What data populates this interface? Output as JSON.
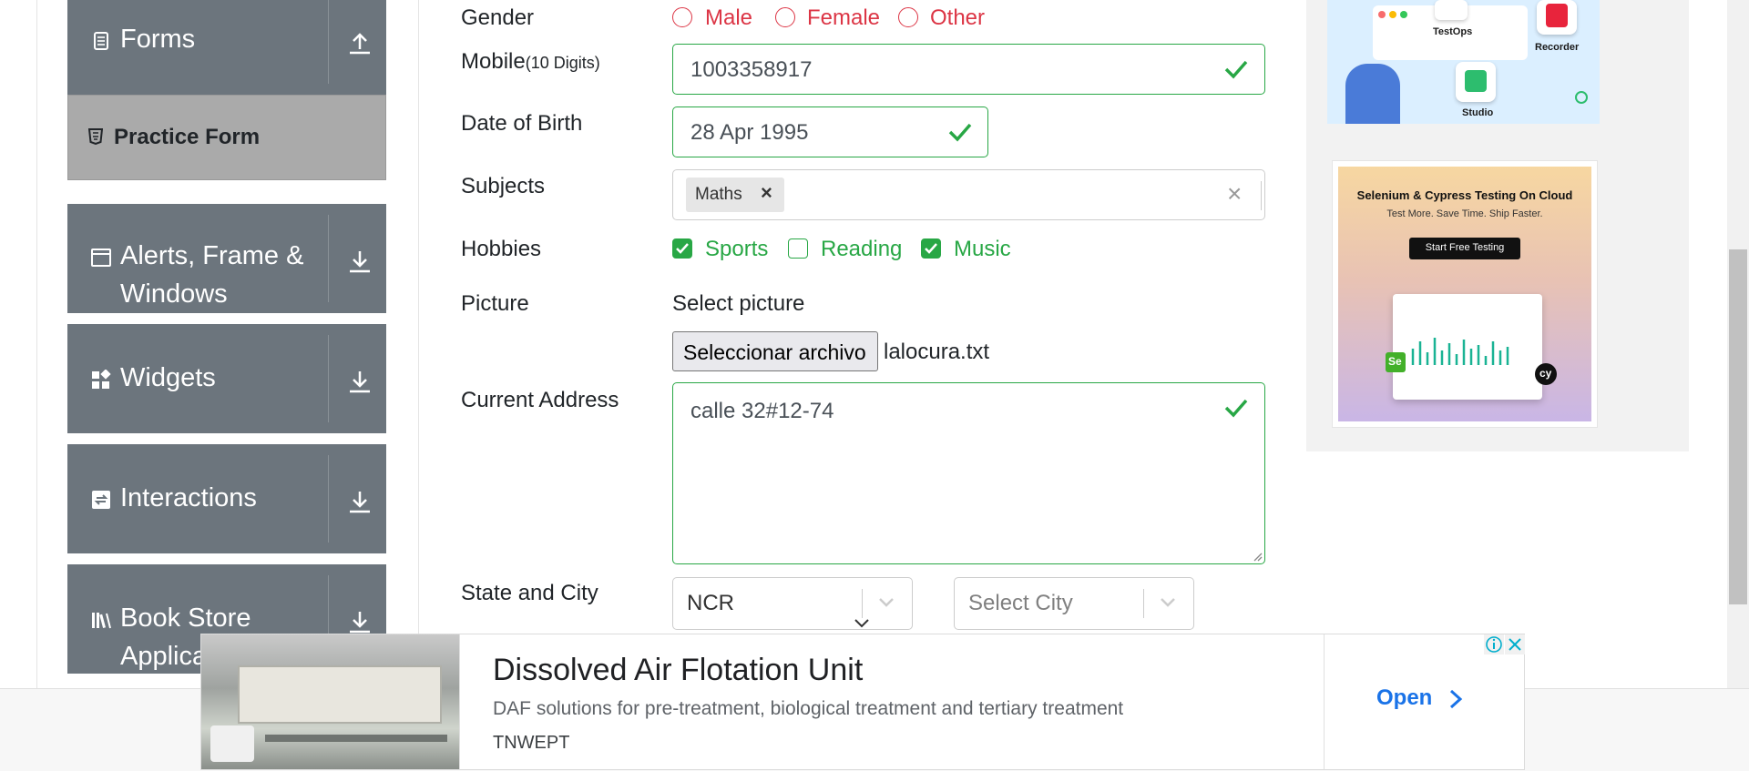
{
  "sidebar": {
    "groups": [
      {
        "label": "Forms",
        "icon": "document-icon",
        "arrow": "upload-arrow-icon"
      },
      {
        "label": "Alerts, Frame &",
        "label2": "Windows",
        "icon": "window-icon",
        "arrow": "download-arrow-icon"
      },
      {
        "label": "Widgets",
        "icon": "widgets-icon",
        "arrow": "download-arrow-icon"
      },
      {
        "label": "Interactions",
        "icon": "interactions-icon",
        "arrow": "download-arrow-icon"
      },
      {
        "label": "Book Store",
        "label2": "Applica",
        "icon": "books-icon",
        "arrow": "download-arrow-icon"
      }
    ],
    "active_item": {
      "label": "Practice Form",
      "icon": "html5-icon"
    }
  },
  "form": {
    "gender": {
      "label": "Gender",
      "options": [
        "Male",
        "Female",
        "Other"
      ]
    },
    "mobile": {
      "label": "Mobile",
      "hint": "(10 Digits)",
      "value": "1003358917"
    },
    "dob": {
      "label": "Date of Birth",
      "value": "28 Apr 1995"
    },
    "subjects": {
      "label": "Subjects",
      "chips": [
        "Maths"
      ],
      "chip_remove": "×",
      "clear": "×"
    },
    "hobbies": {
      "label": "Hobbies",
      "options": [
        {
          "label": "Sports",
          "checked": true
        },
        {
          "label": "Reading",
          "checked": false
        },
        {
          "label": "Music",
          "checked": true
        }
      ]
    },
    "picture": {
      "label": "Picture",
      "prompt": "Select picture",
      "button": "Seleccionar archivo",
      "file_name": "lalocura.txt"
    },
    "address": {
      "label": "Current Address",
      "value": "calle 32#12-74"
    },
    "state_city": {
      "label": "State and City",
      "state_value": "NCR",
      "city_placeholder": "Select City"
    }
  },
  "ads": {
    "right_top": {
      "labels": [
        "TestOps",
        "Recorder",
        "Studio"
      ]
    },
    "right_bottom": {
      "title": "Selenium & Cypress Testing On Cloud",
      "subtitle": "Test More. Save Time. Ship Faster.",
      "button": "Start Free Testing",
      "badges": [
        "Se",
        "cy"
      ]
    },
    "banner": {
      "title": "Dissolved Air Flotation Unit",
      "description": "DAF solutions for pre-treatment, biological treatment and tertiary treatment",
      "advertiser": "TNWEPT",
      "cta": "Open"
    }
  },
  "colors": {
    "sidebar": "#6c757d",
    "active": "#aaaaaa",
    "valid": "#28a745",
    "invalid": "#dc3545",
    "link": "#1a73e8"
  }
}
